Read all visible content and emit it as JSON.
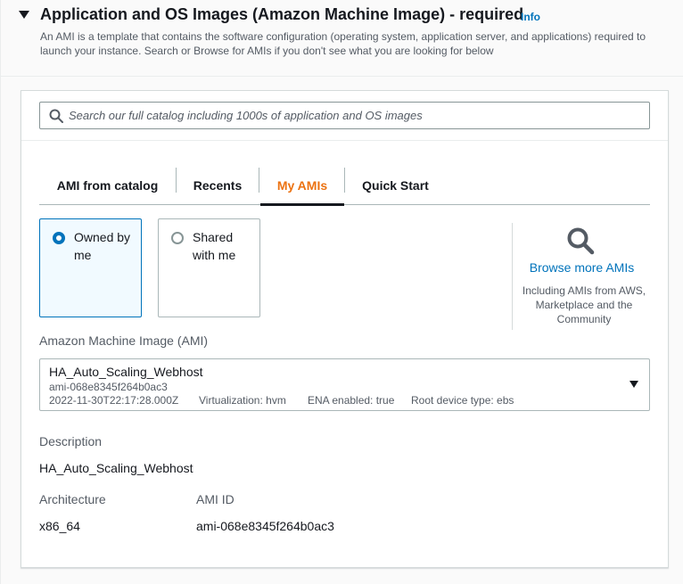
{
  "section": {
    "title": "Application and OS Images (Amazon Machine Image) - required",
    "info_label": "Info",
    "description": "An AMI is a template that contains the software configuration (operating system, application server, and applications) required to launch your instance. Search or Browse for AMIs if you don't see what you are looking for below"
  },
  "search": {
    "placeholder": "Search our full catalog including 1000s of application and OS images"
  },
  "tabs": [
    {
      "label": "AMI from catalog",
      "active": false
    },
    {
      "label": "Recents",
      "active": false
    },
    {
      "label": "My AMIs",
      "active": true
    },
    {
      "label": "Quick Start",
      "active": false
    }
  ],
  "ownership": {
    "options": [
      {
        "label": "Owned by me",
        "selected": true
      },
      {
        "label": "Shared with me",
        "selected": false
      }
    ]
  },
  "browse": {
    "link": "Browse more AMIs",
    "subtitle": "Including AMIs from AWS, Marketplace and the Community"
  },
  "ami": {
    "field_label": "Amazon Machine Image (AMI)",
    "name": "HA_Auto_Scaling_Webhost",
    "id": "ami-068e8345f264b0ac3",
    "created": "2022-11-30T22:17:28.000Z",
    "virtualization": "Virtualization: hvm",
    "ena": "ENA enabled: true",
    "root_device": "Root device type: ebs"
  },
  "details": {
    "description_label": "Description",
    "description_value": "HA_Auto_Scaling_Webhost",
    "architecture_label": "Architecture",
    "architecture_value": "x86_64",
    "ami_id_label": "AMI ID",
    "ami_id_value": "ami-068e8345f264b0ac3"
  },
  "colors": {
    "link": "#0073bb",
    "active_tab": "#ec7211",
    "selected_tile_bg": "#f1faff"
  }
}
